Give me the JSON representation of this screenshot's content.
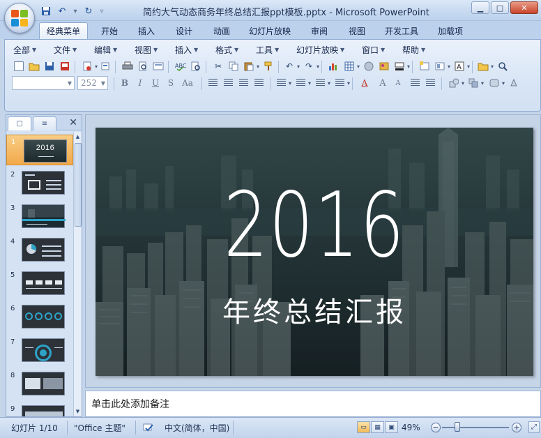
{
  "window": {
    "title": "简约大气动态商务年终总结汇报ppt模板.pptx - Microsoft PowerPoint"
  },
  "ribbon_tabs": [
    "经典菜单",
    "开始",
    "插入",
    "设计",
    "动画",
    "幻灯片放映",
    "审阅",
    "视图",
    "开发工具",
    "加载项"
  ],
  "classic_menu": [
    "全部",
    "文件",
    "编辑",
    "视图",
    "插入",
    "格式",
    "工具",
    "幻灯片放映",
    "窗口",
    "帮助"
  ],
  "format_toolbar": {
    "font_size": "252",
    "bold": "B",
    "italic": "I",
    "underline": "U",
    "strike": "S",
    "case": "Aa",
    "font_color": "A",
    "grow": "A",
    "shrink": "A",
    "zoom_box": "A"
  },
  "slides": [
    {
      "number": "1",
      "thumb_text": "2016"
    },
    {
      "number": "2"
    },
    {
      "number": "3"
    },
    {
      "number": "4"
    },
    {
      "number": "5"
    },
    {
      "number": "6"
    },
    {
      "number": "7"
    },
    {
      "number": "8"
    },
    {
      "number": "9"
    }
  ],
  "current_slide": {
    "title": "2016",
    "subtitle": "年终总结汇报"
  },
  "notes": {
    "placeholder": "单击此处添加备注"
  },
  "statusbar": {
    "slide_position": "幻灯片 1/10",
    "theme": "\"Office 主题\"",
    "language": "中文(简体，中国)",
    "zoom": "49%"
  },
  "colors": {
    "selected_thumb": "#f2a94a",
    "ribbon_bg": "#d8e5f5",
    "slide_overlay": "#1d3a3c"
  },
  "icons": {
    "office_button": "office-logo-icon",
    "qat": [
      "save-icon",
      "undo-icon",
      "redo-icon",
      "customize-qat-icon"
    ],
    "window_controls": [
      "minimize-icon",
      "maximize-icon",
      "close-icon"
    ]
  }
}
